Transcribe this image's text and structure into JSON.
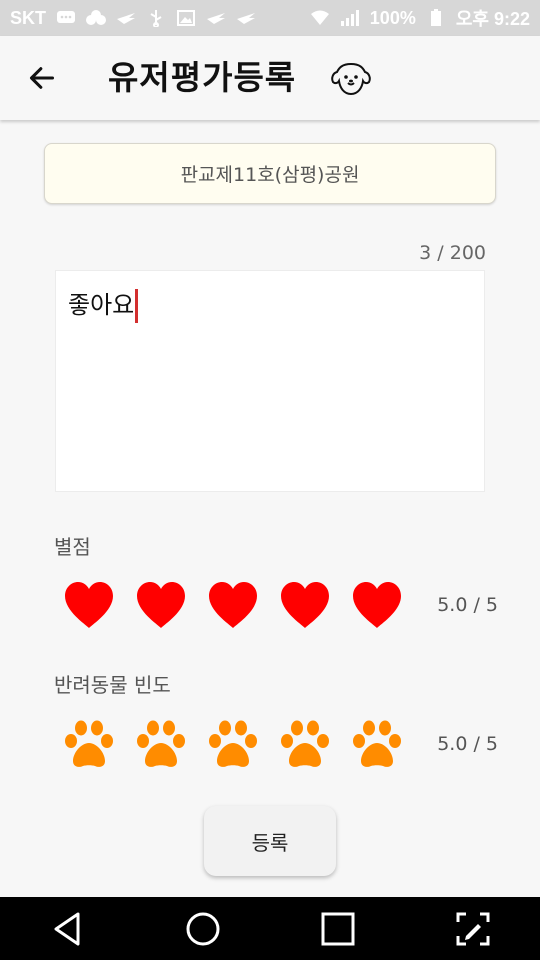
{
  "status_bar": {
    "carrier": "SKT",
    "battery": "100%",
    "time": "오후 9:22"
  },
  "app_bar": {
    "title": "유저평가등록",
    "back_icon": "arrow-left-icon",
    "dog_icon": "dog-face-icon"
  },
  "park": {
    "name": "판교제11호(삼평)공원"
  },
  "review": {
    "counter": "3 / 200",
    "text": "좋아요"
  },
  "rating": {
    "label": "별점",
    "icon": "heart-icon",
    "color": "#ff0000",
    "value": 5.0,
    "max": 5,
    "value_text": "5.0 / 5"
  },
  "pet_frequency": {
    "label": "반려동물 빈도",
    "icon": "paw-icon",
    "color": "#ff8c00",
    "value": 5.0,
    "max": 5,
    "value_text": "5.0 / 5"
  },
  "submit": {
    "label": "등록"
  },
  "nav_bar": {
    "back": "nav-back-icon",
    "home": "nav-home-icon",
    "recents": "nav-recents-icon",
    "edit": "nav-edit-icon"
  }
}
